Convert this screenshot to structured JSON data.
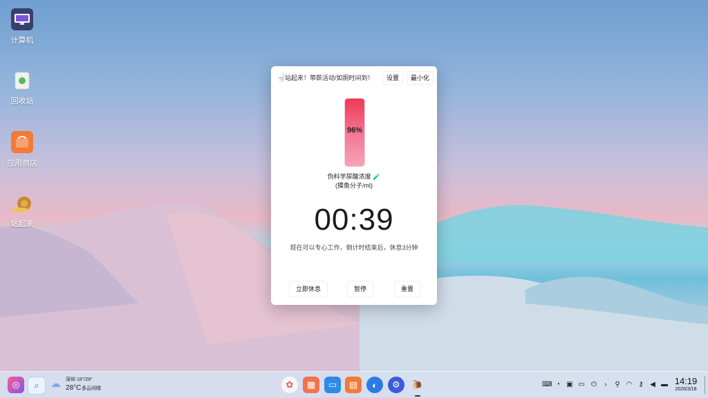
{
  "desktop": {
    "icons": [
      {
        "label": "计算机",
        "icon": "computer-icon"
      },
      {
        "label": "回收站",
        "icon": "trash-icon"
      },
      {
        "label": "应用商店",
        "icon": "app-store-icon"
      },
      {
        "label": "站起来",
        "icon": "snail-icon"
      }
    ]
  },
  "popup": {
    "title": "站起来！带薪活动/如厕时间到！",
    "settings_label": "设置",
    "minimize_label": "最小化",
    "tube_percent_label": "96%",
    "tube_level": 0.96,
    "concentration_label": "伪科学尿酸浓度",
    "concentration_unit": "(摸鱼分子/ml)",
    "timer": "00:39",
    "hint": "现在可以专心工作，倒计时结束后，休息3分钟",
    "actions": {
      "rest_now": "立即休息",
      "pause": "暂停",
      "reset": "重置"
    }
  },
  "taskbar": {
    "weather": {
      "city": "深圳 18°/28°",
      "temp": "28°C",
      "condition": "多云间晴"
    },
    "clock": {
      "time": "14:19",
      "date": "2026/3/18"
    }
  }
}
